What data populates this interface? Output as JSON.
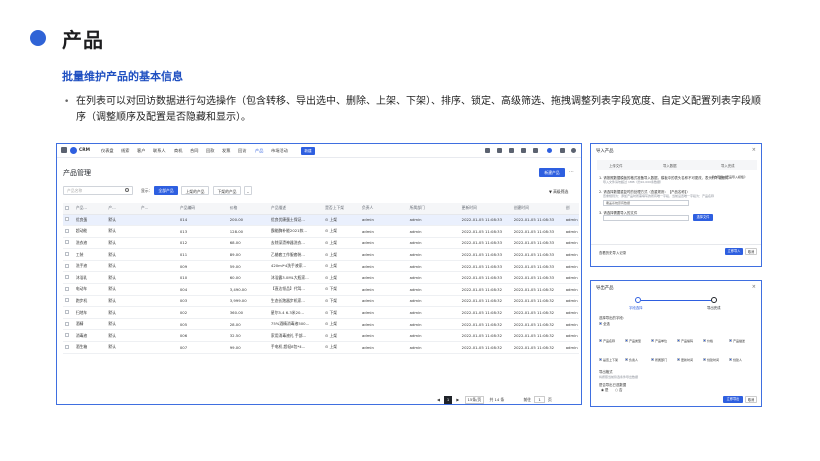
{
  "slide": {
    "title": "产品",
    "subtitle": "批量维护产品的基本信息",
    "bullet": "在列表可以对回访数据进行勾选操作（包含转移、导出选中、删除、上架、下架）、排序、锁定、高级筛选、拖拽调整列表字段宽度、自定义配置列表字段顺序（调整顺序及配置是否隐藏和显示）。"
  },
  "app": {
    "logo": "CRM",
    "nav": [
      "仪表盘",
      "线索",
      "客户",
      "联系人",
      "商机",
      "合同",
      "回款",
      "发票",
      "回访",
      "产品",
      "市场活动"
    ],
    "new_label": "新建",
    "page_title": "产品管理",
    "new_product": "新建产品",
    "more": "···",
    "search_placeholder": "产品名称",
    "show_label": "显示：",
    "filters": [
      "全部产品",
      "上架的产品",
      "下架的产品"
    ],
    "advanced_filter": "高级筛选",
    "columns": [
      "产品...",
      "产...",
      "产...",
      "产品编码",
      "价格",
      "产品描述",
      "是否上下架",
      "负责人",
      "所属部门",
      "更新时间",
      "创建时间",
      "创"
    ],
    "rows": [
      [
        "优良蛋",
        "默认",
        "014",
        "200.00",
        "优良优康蛋土保证...",
        "上架",
        "admin",
        "admin",
        "2022-01-05 11:08:33",
        "2022-01-05 11:08:33",
        "admin"
      ],
      [
        "超动能",
        "默认",
        "013",
        "128.00",
        "霸能酶补能2021款...",
        "上架",
        "admin",
        "admin",
        "2022-01-05 11:08:33",
        "2022-01-05 11:08:33",
        "admin"
      ],
      [
        "洗衣液",
        "默认",
        "012",
        "68.00",
        "去除深渍神器洗衣...",
        "上架",
        "admin",
        "admin",
        "2022-01-05 11:08:33",
        "2022-01-05 11:08:33",
        "admin"
      ],
      [
        "工装",
        "默认",
        "011",
        "89.00",
        "乙蜡套工作服套装...",
        "上架",
        "admin",
        "admin",
        "2022-01-05 11:08:33",
        "2022-01-05 11:08:33",
        "admin"
      ],
      [
        "洗手液",
        "默认",
        "009",
        "59.00",
        "420ml*4洗手液家...",
        "上架",
        "admin",
        "admin",
        "2022-01-05 11:08:33",
        "2022-01-05 11:08:33",
        "admin"
      ],
      [
        "沐浴乳",
        "默认",
        "010",
        "60.00",
        "沐浴露3.0ML大瓶家...",
        "上架",
        "admin",
        "admin",
        "2022-01-05 11:08:33",
        "2022-01-05 11:08:33",
        "admin"
      ],
      [
        "电动车",
        "默认",
        "004",
        "3,490.00",
        "【直达领品】代驾...",
        "下架",
        "admin",
        "admin",
        "2022-01-05 11:08:32",
        "2022-01-05 11:08:32",
        "admin"
      ],
      [
        "跑步机",
        "默认",
        "003",
        "3,999.00",
        "生态长跑器步机家...",
        "下架",
        "admin",
        "admin",
        "2022-01-05 11:08:32",
        "2022-01-05 11:08:32",
        "admin"
      ],
      [
        "扫地车",
        "默认",
        "002",
        "360.00",
        "星尔5.4 6.3米20...",
        "下架",
        "admin",
        "admin",
        "2022-01-05 11:08:32",
        "2022-01-05 11:08:32",
        "admin"
      ],
      [
        "酒精",
        "默认",
        "005",
        "28.00",
        "75%酒精消毒液500...",
        "上架",
        "admin",
        "admin",
        "2022-01-05 11:08:32",
        "2022-01-05 11:08:32",
        "admin"
      ],
      [
        "消毒液",
        "默认",
        "006",
        "32.50",
        "家用消毒液礼 手部...",
        "上架",
        "admin",
        "admin",
        "2022-01-05 11:08:32",
        "2022-01-05 11:08:32",
        "admin"
      ],
      [
        "酒生箱",
        "默认",
        "007",
        "99.00",
        "手电机 超轻8包*4...",
        "上架",
        "admin",
        "admin",
        "2022-01-05 11:08:32",
        "2022-01-05 11:08:32",
        "admin"
      ]
    ],
    "pager": {
      "page": "1",
      "size": "15条/页",
      "total": "共 14 条",
      "goto": "前往",
      "goto_page": "1",
      "unit": "页"
    }
  },
  "import_dialog": {
    "title": "导入产品",
    "steps": [
      "上传文件",
      "导入数据",
      "导入完成"
    ],
    "line1": "1. 请按照数据模板的格式准备导入数据，模板中的表头名称不可更改，表头行不能删除",
    "line1b": "导入文件请勿超过 1MB（约10,000条数据）",
    "link": "点击下载《产品导入模板》",
    "line2": "2. 请选择数据重复时的处理方式（查重规则：【产品名称】）",
    "line2b": "查重规则为：添加产品时所需填写的所有唯一字段，当前设置唯一字段为：产品名称",
    "select": "覆盖系统原有数据",
    "line3": "3. 请选择需要导入的文件",
    "select_file": "选择文件",
    "history": "查看历史导入记录",
    "next": "立即导入",
    "cancel": "取消"
  },
  "export_dialog": {
    "title": "导出产品",
    "steps": [
      "字段选择",
      "导出完成"
    ],
    "choose": "选择导出的字段：",
    "all": "全选",
    "fields": [
      "产品名称",
      "产品类型",
      "产品单位",
      "产品编码",
      "价格",
      "产品描述",
      "是否上下架",
      "负责人",
      "所属部门",
      "更新时间",
      "创建时间",
      "创建人"
    ],
    "format": "导出格式",
    "format_note": "将按照当前筛选条件导出数据",
    "option": "是否导出已选数据",
    "yes": "是",
    "no": "否",
    "export": "立即导出",
    "cancel": "取消"
  },
  "colors": {
    "accent": "#2e5fe0",
    "title_blue": "#1f4fc1",
    "price": "#e8792b"
  }
}
